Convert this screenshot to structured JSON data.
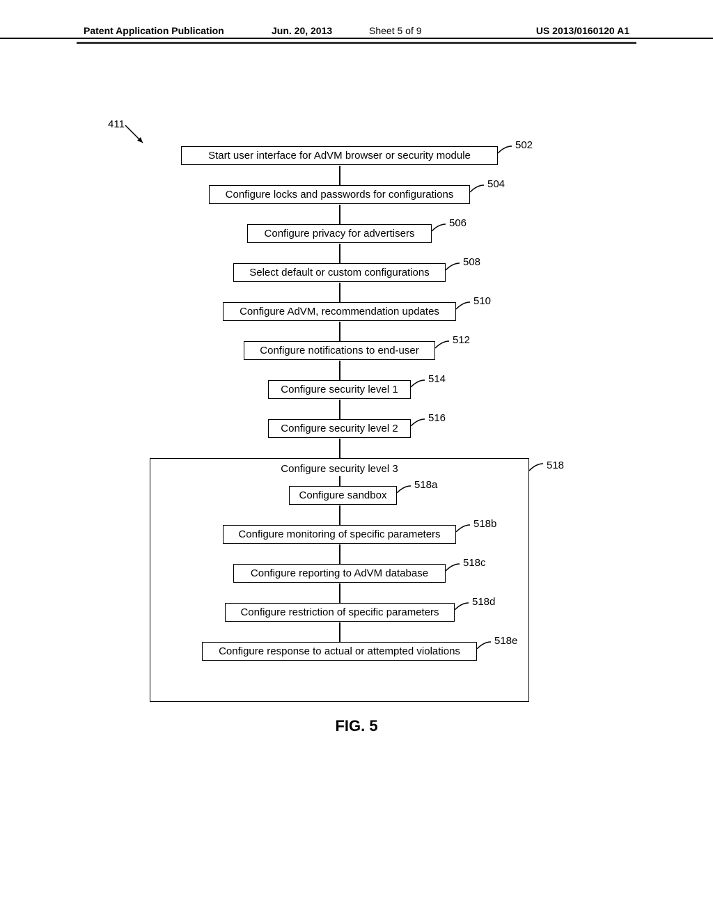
{
  "header": {
    "left": "Patent Application Publication",
    "date": "Jun. 20, 2013",
    "sheet": "Sheet 5 of 9",
    "pubno": "US 2013/0160120 A1"
  },
  "figure": {
    "caption": "FIG. 5",
    "entry_ref": "411"
  },
  "steps": {
    "s502": {
      "text": "Start user interface for AdVM browser or security module",
      "ref": "502"
    },
    "s504": {
      "text": "Configure locks and passwords for configurations",
      "ref": "504"
    },
    "s506": {
      "text": "Configure privacy for advertisers",
      "ref": "506"
    },
    "s508": {
      "text": "Select default or custom configurations",
      "ref": "508"
    },
    "s510": {
      "text": "Configure AdVM, recommendation updates",
      "ref": "510"
    },
    "s512": {
      "text": "Configure notifications to end-user",
      "ref": "512"
    },
    "s514": {
      "text": "Configure security level 1",
      "ref": "514"
    },
    "s516": {
      "text": "Configure security level 2",
      "ref": "516"
    },
    "s518": {
      "title": "Configure security level 3",
      "ref": "518",
      "a": {
        "text": "Configure sandbox",
        "ref": "518a"
      },
      "b": {
        "text": "Configure monitoring of specific parameters",
        "ref": "518b"
      },
      "c": {
        "text": "Configure reporting to AdVM database",
        "ref": "518c"
      },
      "d": {
        "text": "Configure restriction of specific parameters",
        "ref": "518d"
      },
      "e": {
        "text": "Configure response to actual or attempted violations",
        "ref": "518e"
      }
    }
  }
}
